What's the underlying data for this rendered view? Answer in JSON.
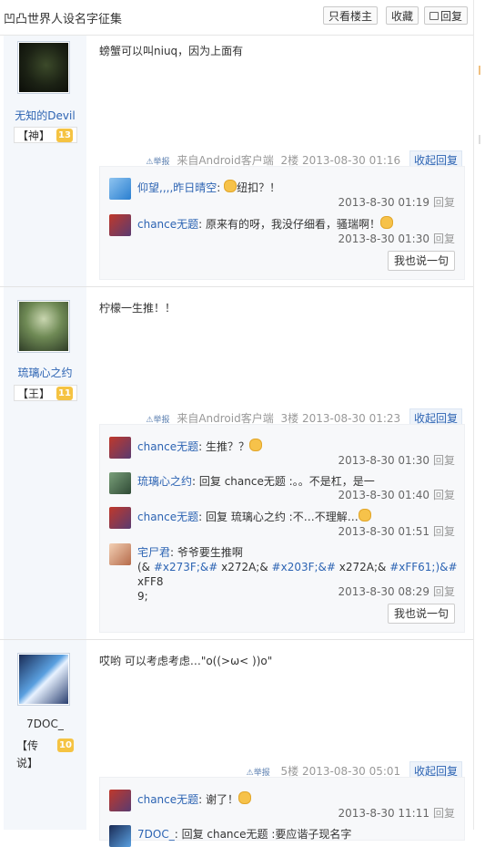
{
  "header": {
    "title": "凹凸世界人设名字征集",
    "only_op_label": "只看楼主",
    "favorite_label": "收藏",
    "reply_label": "回复",
    "reply_icon": "reply-icon"
  },
  "posts": [
    {
      "user": "无知的Devil",
      "title_badge": "【神】",
      "level": "13",
      "content": "螃蟹可以叫niuq，因为上面有",
      "report": "举报",
      "client": "来自Android客户端",
      "floor": "2楼",
      "time": "2013-08-30 01:16",
      "collapse": "收起回复",
      "say_label": "我也说一句",
      "replies": [
        {
          "user": "仰望,,,,昨日晴空",
          "sep": ": ",
          "text": "纽扣？！",
          "time": "2013-8-30 01:19",
          "reply": "回复"
        },
        {
          "user": "chance无题",
          "sep": ": ",
          "text": "原来有的呀，我没仔细看，骚瑞啊！",
          "time": "2013-8-30 01:30",
          "reply": "回复"
        }
      ]
    },
    {
      "user": "琉璃心之约",
      "title_badge": "【王】",
      "level": "11",
      "content": "柠檬一生推！！",
      "report": "举报",
      "client": "来自Android客户端",
      "floor": "3楼",
      "time": "2013-08-30 01:23",
      "collapse": "收起回复",
      "say_label": "我也说一句",
      "replies": [
        {
          "user": "chance无题",
          "sep": ": ",
          "text": "生推？？",
          "time": "2013-8-30 01:30",
          "reply": "回复"
        },
        {
          "user": "琉璃心之约",
          "sep": ": ",
          "text": "回复 chance无题 :。。不是杠，是一",
          "time": "2013-8-30 01:40",
          "reply": "回复"
        },
        {
          "user": "chance无题",
          "sep": ": ",
          "text": "回复 琉璃心之约 :不…不理解…",
          "time": "2013-8-30 01:51",
          "reply": "回复"
        },
        {
          "user": "宅尸君",
          "sep": ": ",
          "text": "爷爷要生推啊",
          "text2_a": "(& ",
          "ent1": "#x273F;&#",
          "text2_b": " x272A;& ",
          "ent2": "#x203F;&#",
          "text2_c": " x272A;& ",
          "ent3": "#xFF61;)&#",
          "text2_d": " xFF8",
          "text3": "9;",
          "time": "2013-8-30 08:29",
          "reply": "回复"
        }
      ]
    },
    {
      "user": "7DOC_",
      "title_badge_a": "【传",
      "title_badge_b": "说】",
      "level": "10",
      "content": "哎哟 可以考虑考虑…\"o((>ω< ))o\"",
      "report": "举报",
      "floor": "5楼",
      "time": "2013-08-30 05:01",
      "collapse": "收起回复",
      "replies": [
        {
          "user": "chance无题",
          "sep": ": ",
          "text": "谢了！",
          "time": "2013-8-30 11:11",
          "reply": "回复"
        },
        {
          "user": "7DOC_",
          "sep": ": ",
          "text": "回复 chance无题 :要应谐子现名字"
        }
      ]
    }
  ],
  "colors": {
    "link": "#2d64b3",
    "sidebar_bg": "#f4f7fb",
    "lzl_bg": "#f7f8fa",
    "level_badge": "#f5c342"
  }
}
